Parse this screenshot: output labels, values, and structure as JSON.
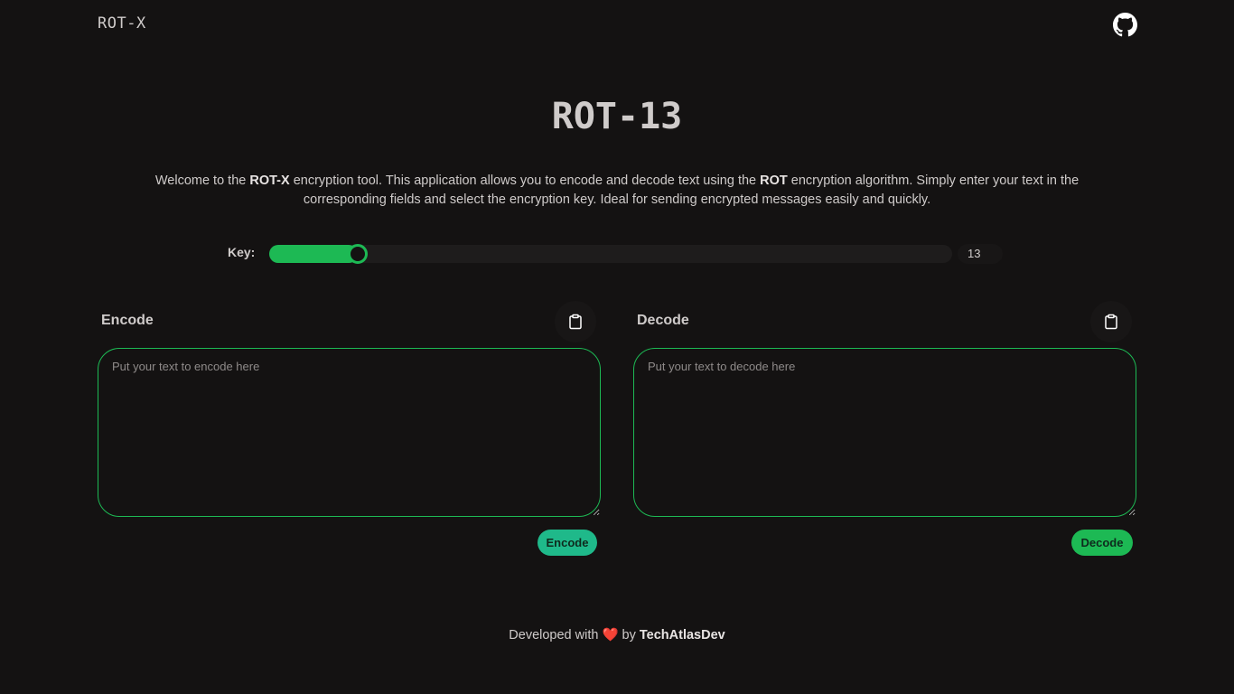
{
  "header": {
    "logo": "ROT-X",
    "github_icon": "github-icon"
  },
  "title": "ROT-13",
  "intro": {
    "part1": "Welcome to the ",
    "bold1": "ROT-X",
    "part2": " encryption tool. This application allows you to encode and decode text using the ",
    "bold2": "ROT",
    "part3": " encryption algorithm. Simply enter your text in the corresponding fields and select the encryption key. Ideal for sending encrypted messages easily and quickly."
  },
  "key": {
    "label": "Key:",
    "value": 13,
    "value_text": "13",
    "min": 0,
    "max": 100,
    "accent": "#1db954"
  },
  "encode": {
    "label": "Encode",
    "placeholder": "Put your text to encode here",
    "button": "Encode",
    "button_color": "#1fb98a",
    "clipboard_icon": "clipboard-icon"
  },
  "decode": {
    "label": "Decode",
    "placeholder": "Put your text to decode here",
    "button": "Decode",
    "button_color": "#1db954",
    "clipboard_icon": "clipboard-icon"
  },
  "footer": {
    "prefix": "Developed with ",
    "heart": "❤️",
    "by": " by ",
    "author": "TechAtlasDev"
  }
}
